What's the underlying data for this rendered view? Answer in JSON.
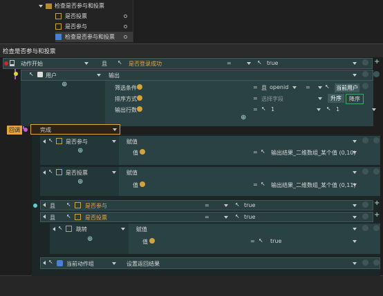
{
  "tree": {
    "items": [
      {
        "label": "检查是否参与和投票",
        "tag": "A"
      },
      {
        "label": "是否投票",
        "tag": "A"
      },
      {
        "label": "是否参与",
        "tag": "A"
      },
      {
        "label": "检查是否参与和投票",
        "tag": "A"
      }
    ]
  },
  "panel": {
    "title": "检查是否参与和投票"
  },
  "row_trigger": {
    "label": "动作开始",
    "op": "且",
    "cond": "是否登录成功",
    "eq": "=",
    "val": "true"
  },
  "row_user": {
    "label": "用户",
    "action": "输出",
    "filter_label": "筛选条件",
    "filter_op": "且",
    "filter_field": "openid",
    "filter_eq": "=",
    "filter_val": "当前用户",
    "sort_label": "排序方式",
    "sort_eq": "=",
    "sort_placeholder": "选择字段",
    "sort_asc": "升序",
    "sort_desc": "降序",
    "rows_label": "输出行数",
    "rows_eq": "=",
    "rows_a": "1",
    "rows_b": "1"
  },
  "callback": {
    "tag": "回调",
    "label": "完成"
  },
  "assign1": {
    "name": "是否参与",
    "action": "赋值",
    "val_label": "值",
    "eq": "=",
    "value": "输出结果_二维数组_某个值 (0,10)"
  },
  "assign2": {
    "name": "是否投票",
    "action": "赋值",
    "val_label": "值",
    "eq": "=",
    "value": "输出结果_二维数组_某个值 (0,11)"
  },
  "cond1": {
    "op": "且",
    "var": "是否参与",
    "eq": "=",
    "val": "true"
  },
  "cond2": {
    "op": "且",
    "var": "是否投票",
    "eq": "=",
    "val": "true"
  },
  "jump": {
    "label": "跳转",
    "action": "赋值",
    "val_label": "值",
    "eq": "=",
    "value": "true"
  },
  "current": {
    "label": "当前动作组",
    "action": "设置返回结果"
  },
  "colors": {
    "accent": "#e8a640",
    "teal": "#2e4a4c"
  }
}
